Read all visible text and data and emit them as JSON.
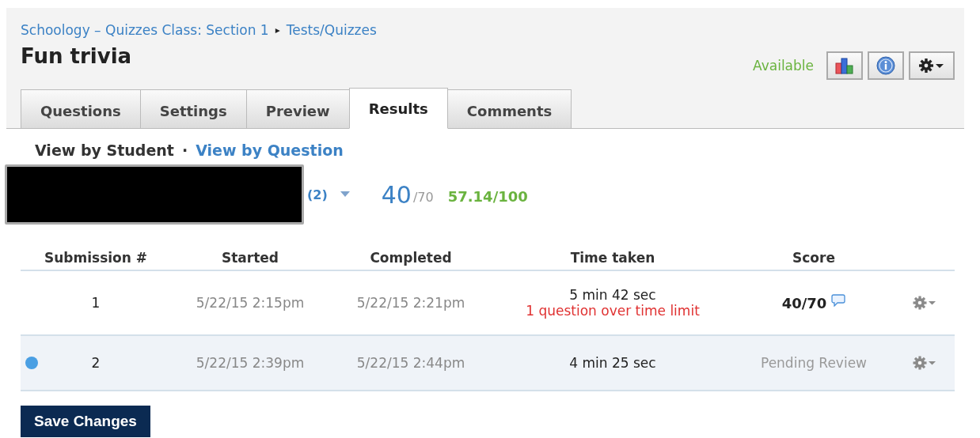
{
  "breadcrumb": [
    {
      "label": "Schoology – Quizzes Class: Section 1"
    },
    {
      "label": "Tests/Quizzes"
    }
  ],
  "breadcrumb_separator": "▸",
  "title": "Fun trivia",
  "status": "Available",
  "tabs": [
    {
      "label": "Questions",
      "selected": false
    },
    {
      "label": "Settings",
      "selected": false
    },
    {
      "label": "Preview",
      "selected": false
    },
    {
      "label": "Results",
      "selected": true
    },
    {
      "label": "Comments",
      "selected": false
    }
  ],
  "views": [
    {
      "label": "View by Student",
      "selected": true
    },
    {
      "label": "View by Question",
      "selected": false
    }
  ],
  "view_separator": "·",
  "student": {
    "attempts": "(2)",
    "score": "40",
    "max": "/70",
    "percent": "57.14/100"
  },
  "table": {
    "columns": [
      "Submission #",
      "Started",
      "Completed",
      "Time taken",
      "Score"
    ],
    "rows": [
      {
        "number": "1",
        "started": "5/22/15 2:15pm",
        "completed": "5/22/15 2:21pm",
        "time": "5 min 42 sec",
        "note": "1 question over time limit",
        "score": "40/70",
        "kind": "graded",
        "unread": false
      },
      {
        "number": "2",
        "started": "5/22/15 2:39pm",
        "completed": "5/22/15 2:44pm",
        "time": "4 min 25 sec",
        "score": "Pending Review",
        "kind": "pending",
        "unread": true
      }
    ]
  },
  "save_button": "Save Changes"
}
